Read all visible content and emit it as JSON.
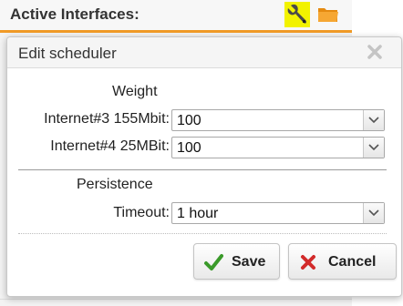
{
  "page": {
    "title": "Active Interfaces:"
  },
  "icons": {
    "wrench": "wrench-icon",
    "folder": "folder-icon",
    "close": "close-icon",
    "save": "checkmark-icon",
    "cancel": "x-icon"
  },
  "colors": {
    "accent_orange": "#f19a26",
    "highlight_yellow": "#f2f200",
    "save_green": "#3a9a2a",
    "cancel_red": "#d22a2a"
  },
  "dialog": {
    "title": "Edit scheduler",
    "weight_section": {
      "heading": "Weight",
      "rows": [
        {
          "label": "Internet#3 155Mbit:",
          "value": "100"
        },
        {
          "label": "Internet#4 25MBit:",
          "value": "100"
        }
      ]
    },
    "persistence_section": {
      "heading": "Persistence",
      "timeout_label": "Timeout:",
      "timeout_value": "1 hour"
    },
    "buttons": {
      "save": "Save",
      "cancel": "Cancel"
    }
  }
}
